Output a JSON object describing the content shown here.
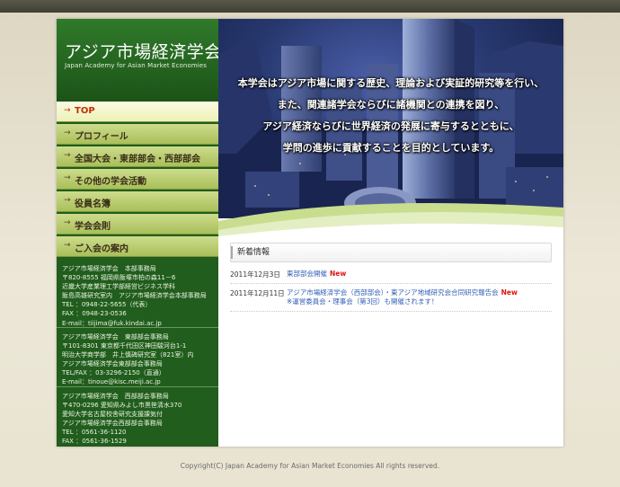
{
  "site": {
    "title": "アジア市場経済学会",
    "subtitle": "Japan Academy for Asian Market Economies"
  },
  "nav": {
    "arrow": "→",
    "items": [
      {
        "label": "TOP"
      },
      {
        "label": "プロフィール"
      },
      {
        "label": "全国大会・東部部会・西部部会"
      },
      {
        "label": "その他の学会活動"
      },
      {
        "label": "役員名簿"
      },
      {
        "label": "学会会則"
      },
      {
        "label": "ご入会の案内"
      }
    ]
  },
  "offices": [
    {
      "lines": [
        "アジア市場経済学会　本部事務局",
        "〒820-8555 福岡県飯塚市柏の森11－6",
        "近畿大学産業理工学部経営ビジネス学科",
        "飯島高雄研究室内　アジア市場経済学会本部事務局",
        "TEL ：0948-22-5655（代表）",
        "FAX ：0948-23-0536",
        "E-mail：tiijima@fuk.kindai.ac.jp"
      ]
    },
    {
      "lines": [
        "アジア市場経済学会　東部部会事務局",
        "〒101-8301 東京都千代田区神田駿河台1-1",
        "明治大学商学部　井上慎碑研究室（821室）内",
        "アジア市場経済学会東部部会事務局",
        "TEL/FAX ：03-3296-2150（直通）",
        "E-mail：tinoue@kisc.meiji.ac.jp"
      ]
    },
    {
      "lines": [
        "アジア市場経済学会　西部部会事務局",
        "〒470-0296 愛知県みよし市黒笹清水370",
        "愛知大学名古屋校舎研究支援課気付",
        "アジア市場経済学会西部部会事務局",
        "TEL ：0561-36-1120",
        "FAX ：0561-36-1529"
      ]
    }
  ],
  "hero": {
    "lines": [
      "本学会はアジア市場に関する歴史、理論および実証的研究等を行い、",
      "また、関連諸学会ならびに諸機関との連携を図り、",
      "アジア経済ならびに世界経済の発展に寄与するとともに、",
      "学問の進歩に貢献することを目的としています。"
    ]
  },
  "news": {
    "heading": "新着情報",
    "new_badge": "New",
    "items": [
      {
        "date": "2011年12月3日",
        "text": "東部部会開催",
        "text2": ""
      },
      {
        "date": "2011年12月11日",
        "text": "アジア市場経済学会（西部部会）・東アジア地域研究会合同研究報告会",
        "text2": "※運営委員会・理事会（第3回）も開催されます！"
      }
    ]
  },
  "footer": {
    "copyright": "Copyright(C) Japan Academy for Asian Market Economies All rights reserved."
  }
}
